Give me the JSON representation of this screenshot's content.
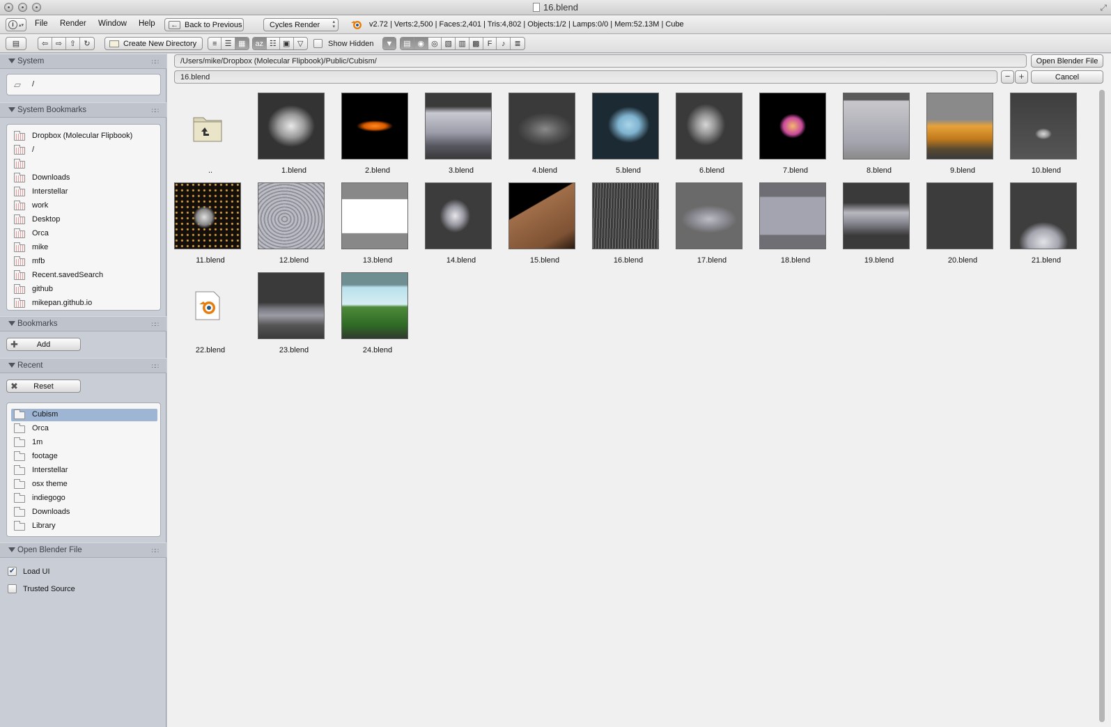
{
  "window": {
    "title": "16.blend"
  },
  "header": {
    "menus": [
      "File",
      "Render",
      "Window",
      "Help"
    ],
    "back_button": "Back to Previous",
    "render_engine": "Cycles Render",
    "info": "v2.72 | Verts:2,500 | Faces:2,401 | Tris:4,802 | Objects:1/2 | Lamps:0/0 | Mem:52.13M | Cube"
  },
  "toolbar": {
    "create_dir": "Create New Directory",
    "show_hidden": "Show Hidden"
  },
  "sidebar": {
    "system": {
      "title": "System",
      "items": [
        "/"
      ]
    },
    "system_bookmarks": {
      "title": "System Bookmarks",
      "items": [
        "Dropbox (Molecular Flipbook)",
        "/",
        "",
        "Downloads",
        "Interstellar",
        "work",
        "Desktop",
        "Orca",
        "mike",
        "mfb",
        "Recent.savedSearch",
        "github",
        "mikepan.github.io"
      ]
    },
    "bookmarks": {
      "title": "Bookmarks",
      "add_label": "Add"
    },
    "recent": {
      "title": "Recent",
      "reset_label": "Reset",
      "items": [
        "Cubism",
        "Orca",
        "1m",
        "footage",
        "Interstellar",
        "osx theme",
        "indiegogo",
        "Downloads",
        "Library"
      ],
      "selected": "Cubism"
    },
    "open_options": {
      "title": "Open Blender File",
      "load_ui": "Load UI",
      "load_ui_checked": true,
      "trusted_source": "Trusted Source",
      "trusted_source_checked": false
    }
  },
  "main": {
    "path": "/Users/mike/Dropbox (Molecular Flipbook)/Public/Cubism/",
    "filename": "16.blend",
    "open_button": "Open Blender File",
    "cancel_button": "Cancel",
    "files": [
      "..",
      "1.blend",
      "2.blend",
      "3.blend",
      "4.blend",
      "5.blend",
      "6.blend",
      "7.blend",
      "8.blend",
      "9.blend",
      "10.blend",
      "11.blend",
      "12.blend",
      "13.blend",
      "14.blend",
      "15.blend",
      "16.blend",
      "17.blend",
      "18.blend",
      "19.blend",
      "20.blend",
      "21.blend",
      "22.blend",
      "23.blend",
      "24.blend"
    ],
    "thumbnails": {
      "1.blend": "white-particle-burst",
      "2.blend": "orange-glow-on-black",
      "3.blend": "grey-mountain-terrain",
      "4.blend": "grey-particle-wave",
      "5.blend": "blue-particle-cloud",
      "6.blend": "grey-coil-knot",
      "7.blend": "orange-sphere-with-pink-rings",
      "8.blend": "grey-plane",
      "9.blend": "orange-particles-on-grey",
      "10.blend": "spinning-top",
      "11.blend": "chrome-sphere-in-particles",
      "12.blend": "grey-striped-shell",
      "13.blend": "grey-tube-on-white",
      "14.blend": "grey-spiky-creature",
      "15.blend": "brown-cube-on-black",
      "16.blend": "grey-strands",
      "17.blend": "grey-rocks",
      "18.blend": "small-shapes-on-grey",
      "19.blend": "grey-curved-surface",
      "20.blend": "empty-dark-grey",
      "21.blend": "grey-mesh-dome",
      "22.blend": "blender-file-icon",
      "23.blend": "grey-tower-on-plane",
      "24.blend": "green-hills-blue-sky"
    }
  }
}
